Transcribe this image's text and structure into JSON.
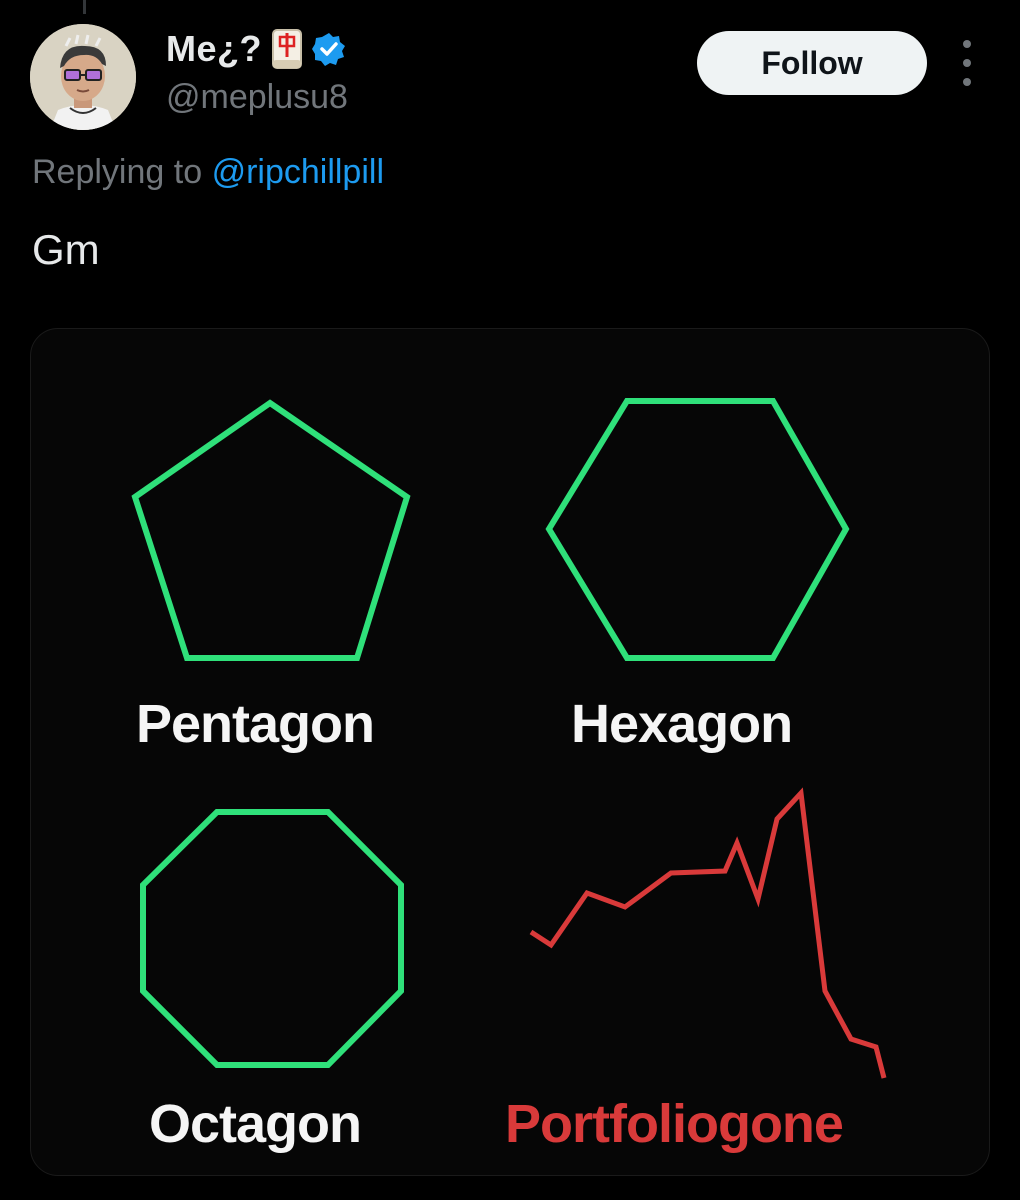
{
  "tweet": {
    "author": {
      "display_name": "Me¿?",
      "handle": "@meplusu8",
      "badge_emoji": "mahjong-red-dragon-icon",
      "verified": true
    },
    "follow_label": "Follow",
    "reply_prefix": "Replying to",
    "reply_mention": "@ripchillpill",
    "text": "Gm",
    "media": {
      "labels": {
        "pentagon": "Pentagon",
        "hexagon": "Hexagon",
        "octagon": "Octagon",
        "portfolio": "Portfoliogone"
      },
      "shape_color": "#2fe07a",
      "portfolio_color": "#d93a3a"
    }
  },
  "colors": {
    "background": "#000000",
    "primary_text": "#e7e9ea",
    "secondary_text": "#71767b",
    "link": "#1d9bf0",
    "verified": "#1d9bf0"
  }
}
